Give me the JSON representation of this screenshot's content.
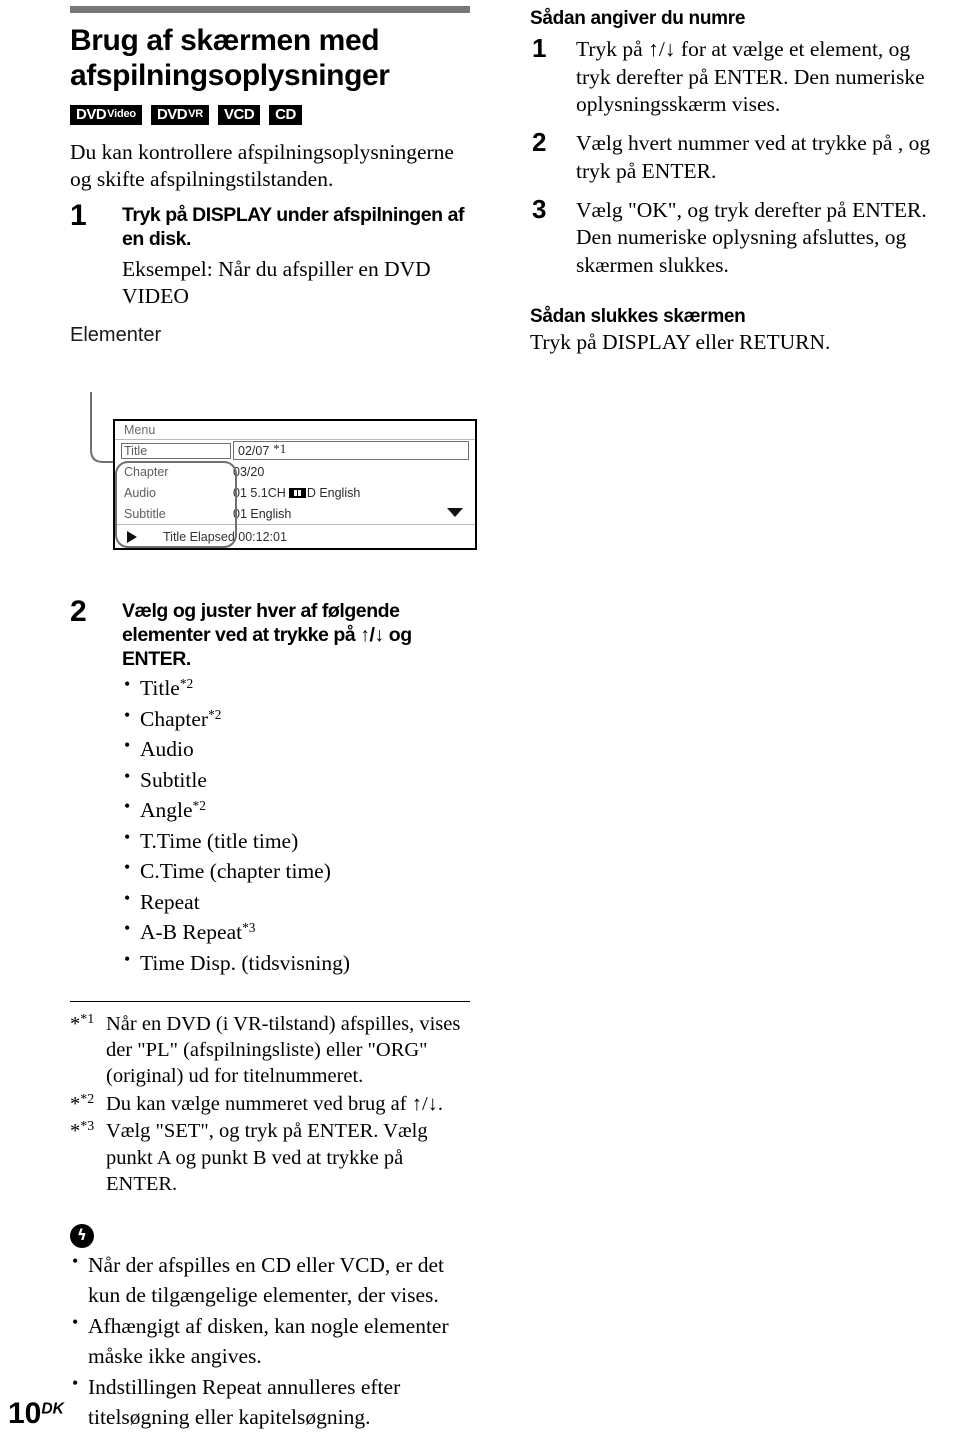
{
  "page": {
    "number": "10",
    "region_code": "DK"
  },
  "left": {
    "title": "Brug af skærmen med afspilningsoplysninger",
    "badges": [
      {
        "name": "dvd-video-badge",
        "main": "DVD",
        "sub": "Video"
      },
      {
        "name": "dvd-vr-badge",
        "main": "DVD",
        "sub": "VR"
      },
      {
        "name": "vcd-badge",
        "main": "VCD",
        "sub": ""
      },
      {
        "name": "cd-badge",
        "main": "CD",
        "sub": ""
      }
    ],
    "intro": "Du kan kontrollere afspilningsoplysningerne og skifte afspilningstilstanden.",
    "step1": {
      "number": "1",
      "title": "Tryk på DISPLAY under afspilningen af en disk.",
      "body": "Eksempel: Når du afspiller en DVD VIDEO"
    },
    "elementer_label": "Elementer",
    "osd": {
      "menu_label": "Menu",
      "rows": [
        {
          "label": "Title",
          "value": "02/07",
          "footnote": "*1",
          "selected": true
        },
        {
          "label": "Chapter",
          "value": "03/20",
          "footnote": "",
          "selected": false
        },
        {
          "label": "Audio",
          "value_pre": "01 5.1CH ",
          "value_post": "D English",
          "dolby": true,
          "selected": false
        },
        {
          "label": "Subtitle",
          "value": "01 English",
          "footnote": "",
          "selected": false,
          "chevron": true
        }
      ],
      "footer": "Title Elapsed 00:12:01"
    },
    "step2": {
      "number": "2",
      "title": "Vælg og juster hver af følgende elementer ved at trykke på ↑/↓ og ENTER.",
      "items": [
        {
          "text": "Title",
          "sup": "*2"
        },
        {
          "text": "Chapter",
          "sup": "*2"
        },
        {
          "text": "Audio",
          "sup": ""
        },
        {
          "text": "Subtitle",
          "sup": ""
        },
        {
          "text": "Angle",
          "sup": "*2"
        },
        {
          "text": "T.Time (title time)",
          "sup": ""
        },
        {
          "text": "C.Time (chapter time)",
          "sup": ""
        },
        {
          "text": "Repeat",
          "sup": ""
        },
        {
          "text": "A-B Repeat",
          "sup": "*3"
        },
        {
          "text": "Time Disp. (tidsvisning)",
          "sup": ""
        }
      ]
    },
    "footnotes": [
      {
        "mark": "*1",
        "text": "Når en DVD (i VR-tilstand) afspilles, vises der \"PL\" (afspilningsliste) eller \"ORG\" (original) ud for titelnummeret."
      },
      {
        "mark": "*2",
        "text": "Du kan vælge nummeret ved brug af ↑/↓."
      },
      {
        "mark": "*3",
        "text": "Vælg \"SET\", og tryk på ENTER. Vælg punkt A og punkt B ved at trykke på ENTER."
      }
    ],
    "note": {
      "icon_glyph": "ϟ",
      "items": [
        "Når der afspilles en CD eller VCD, er det kun de tilgængelige elementer, der vises.",
        "Afhængigt af disken, kan nogle elementer måske ikke angives.",
        "Indstillingen Repeat annulleres efter titelsøgning eller kapitelsøgning."
      ]
    }
  },
  "right": {
    "heading1": "Sådan angiver du numre",
    "steps": [
      {
        "number": "1",
        "text": "Tryk på ↑/↓ for at vælge et element, og tryk derefter på ENTER. Den numeriske oplysningsskærm vises."
      },
      {
        "number": "2",
        "text": "Vælg hvert nummer ved at trykke på , og tryk på ENTER."
      },
      {
        "number": "3",
        "text": "Vælg \"OK\", og tryk derefter på ENTER. Den numeriske oplysning afsluttes, og skærmen slukkes."
      }
    ],
    "heading2": "Sådan slukkes skærmen",
    "heading2_body": "Tryk på DISPLAY eller RETURN."
  },
  "colors": {
    "rule_gray": "#77777a",
    "badge_bg": "#000000",
    "osd_border": "#000000",
    "callout_gray": "#6f6f6f"
  }
}
